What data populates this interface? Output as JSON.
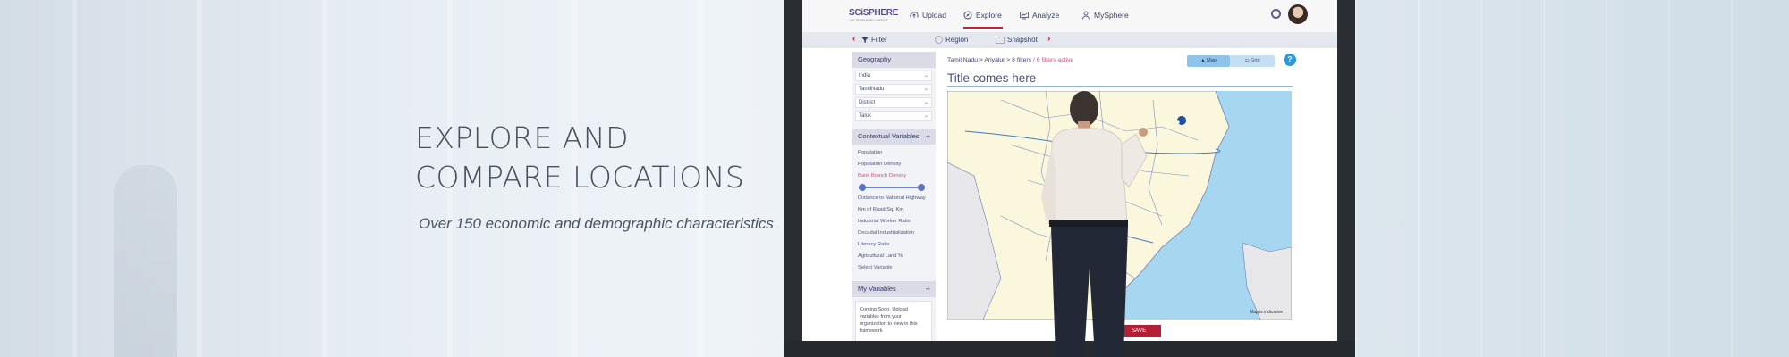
{
  "hero": {
    "title_line1": "EXPLORE AND",
    "title_line2": "COMPARE LOCATIONS",
    "subtitle": "Over 150 economic and demographic characteristics"
  },
  "app": {
    "logo": "SCiSPHERE",
    "logo_tagline": "LOCATION INTELLIGENCE",
    "nav": [
      {
        "label": "Upload",
        "icon": "upload-icon"
      },
      {
        "label": "Explore",
        "icon": "compass-icon",
        "active": true
      },
      {
        "label": "Analyze",
        "icon": "chart-icon"
      },
      {
        "label": "MySphere",
        "icon": "user-icon"
      }
    ],
    "subnav": {
      "filter": "Filter",
      "region": "Region",
      "snapshot": "Snapshot"
    },
    "sidebar": {
      "geography_heading": "Geography",
      "geography_selects": [
        "India",
        "TamilNadu",
        "District",
        "Taluk"
      ],
      "contextual_heading": "Contextual Variables",
      "contextual_plus": "+",
      "variables": [
        "Population",
        "Population Density",
        "Bank Branch Density",
        "Distance to National Highway",
        "Km of Road/Sq. Km",
        "Industrial Worker Ratio",
        "Decadal Industrialization",
        "Literacy Ratio",
        "Agricultural Land %",
        "Select Variable"
      ],
      "highlighted_variable_index": 2,
      "my_variables_heading": "My Variables",
      "my_variables_plus": "+",
      "my_variables_note": "Coming Soon. Upload variables from your organization to view in this framework"
    },
    "breadcrumb": "Tamil Nadu > Ariyalur > 8 filters",
    "filters_active": "/ 6 filters active",
    "map_toggle": {
      "map": "Map",
      "grid": "Grid"
    },
    "help": "?",
    "chart_title": "Title comes here",
    "map_note": "Map is indicative",
    "save_button": "SAVE"
  },
  "colors": {
    "accent_red": "#b51f36",
    "nav_text": "#39406a",
    "highlight_pink": "#d24e83",
    "map_water": "#a7d7f0",
    "map_land": "#fbf7dc",
    "help_blue": "#2f98dd"
  }
}
